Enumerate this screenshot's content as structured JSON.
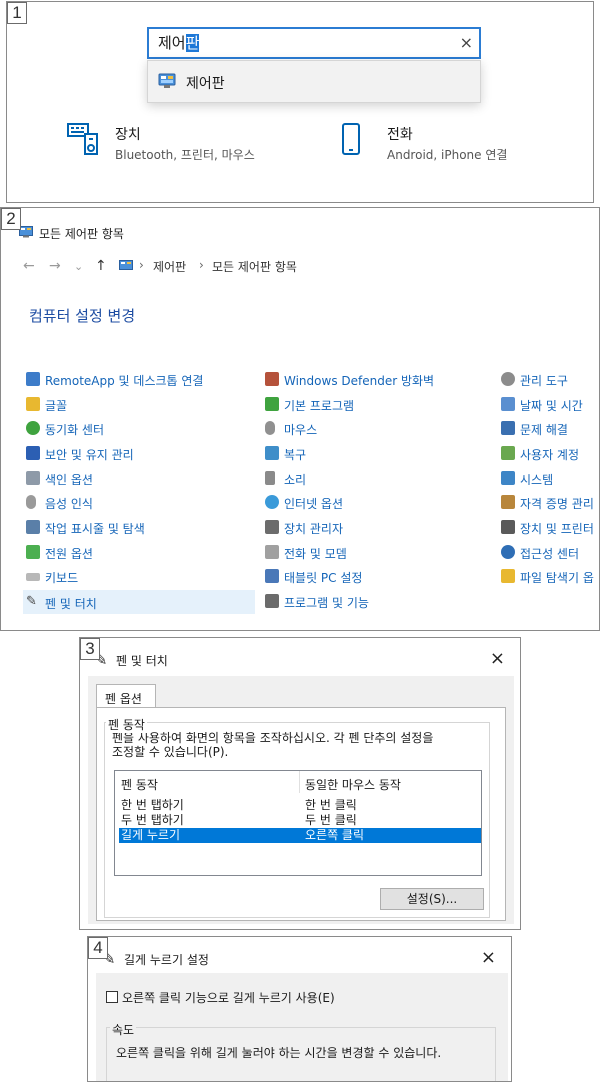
{
  "panel1": {
    "step": "1",
    "search": {
      "value_plain": "제어",
      "value_selected": "판",
      "clear": "×"
    },
    "suggestion": {
      "label": "제어판"
    },
    "devices": {
      "title": "장치",
      "subtitle": "Bluetooth, 프린터, 마우스"
    },
    "phone": {
      "title": "전화",
      "subtitle": "Android, iPhone 연결"
    }
  },
  "panel2": {
    "step": "2",
    "window_title": "모든 제어판 항목",
    "nav": {
      "back": "←",
      "forward": "→",
      "down": "⌄",
      "up": "↑"
    },
    "breadcrumb": [
      "제어판",
      "모든 제어판 항목"
    ],
    "breadcrumb_sep": "›",
    "heading": "컴퓨터 설정 변경",
    "col1": [
      "RemoteApp 및 데스크톱 연결",
      "글꼴",
      "동기화 센터",
      "보안 및 유지 관리",
      "색인 옵션",
      "음성 인식",
      "작업 표시줄 및 탐색",
      "전원 옵션",
      "키보드",
      "펜 및 터치"
    ],
    "col2": [
      "Windows Defender 방화벽",
      "기본 프로그램",
      "마우스",
      "복구",
      "소리",
      "인터넷 옵션",
      "장치 관리자",
      "전화 및 모뎀",
      "태블릿 PC 설정",
      "프로그램 및 기능"
    ],
    "col3": [
      "관리 도구",
      "날짜 및 시간",
      "문제 해결",
      "사용자 계정",
      "시스템",
      "자격 증명 관리",
      "장치 및 프린터",
      "접근성 센터",
      "파일 탐색기 옵"
    ],
    "colors": {
      "link": "#1565b8",
      "heading": "#1f4ea3",
      "selected_bg": "#e5f1fb"
    }
  },
  "panel3": {
    "step": "3",
    "title": "펜 및 터치",
    "close": "×",
    "tab": "펜 옵션",
    "group": "펜 동작",
    "desc_line1": "펜을 사용하여 화면의 항목을 조작하십시오. 각 펜 단추의 설정을",
    "desc_line2": "조정할 수 있습니다(P).",
    "columns": [
      "펜 동작",
      "동일한 마우스 동작"
    ],
    "rows": [
      {
        "action": "한 번 탭하기",
        "mouse": "한 번 클릭"
      },
      {
        "action": "두 번 탭하기",
        "mouse": "두 번 클릭"
      },
      {
        "action": "길게 누르기",
        "mouse": "오른쪽 클릭"
      }
    ],
    "selected_row": 2,
    "settings_button": "설정(S)...",
    "colors": {
      "selection": "#0078d7"
    }
  },
  "panel4": {
    "step": "4",
    "title": "길게 누르기 설정",
    "close": "×",
    "checkbox_label": "오른쪽 클릭 기능으로 길게 누르기 사용(E)",
    "checkbox_checked": false,
    "speed_group": "속도",
    "speed_desc": "오른쪽 클릭을 위해 길게 눌러야 하는 시간을 변경할 수 있습니다."
  }
}
